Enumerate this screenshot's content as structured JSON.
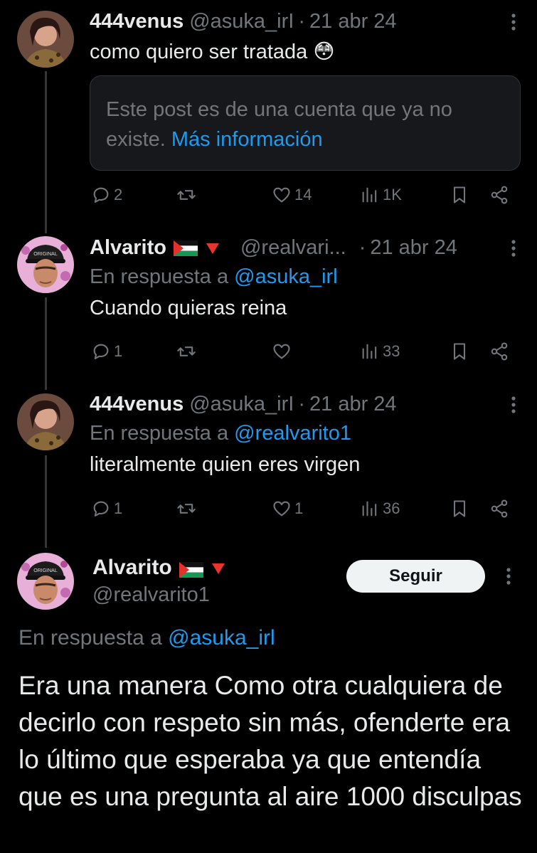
{
  "tweets": [
    {
      "name": "444venus",
      "handle": "@asuka_irI",
      "dot": "·",
      "date": "21 abr 24",
      "text": "como quiero ser tratada 😳",
      "deleted_text": "Este post es de una cuenta que ya no existe.",
      "deleted_link": "Más información",
      "replies": "2",
      "retweets": "",
      "likes": "14",
      "views": "1K"
    },
    {
      "name": "Alvarito",
      "handle": "@realvari...",
      "dot": "·",
      "date": "21 abr 24",
      "reply_prefix": "En respuesta a",
      "reply_to": "@asuka_irl",
      "text": "Cuando quieras reina",
      "replies": "1",
      "retweets": "",
      "likes": "",
      "views": "33"
    },
    {
      "name": "444venus",
      "handle": "@asuka_irI",
      "dot": "·",
      "date": "21 abr 24",
      "reply_prefix": "En respuesta a",
      "reply_to": "@realvarito1",
      "text": "literalmente quien eres virgen",
      "replies": "1",
      "retweets": "",
      "likes": "1",
      "views": "36"
    }
  ],
  "main_tweet": {
    "name": "Alvarito",
    "handle": "@realvarito1",
    "follow_label": "Seguir",
    "reply_prefix": "En respuesta a",
    "reply_to": "@asuka_irl",
    "text": "Era una manera Como otra cualquiera de decirlo con respeto sin más, ofenderte era lo último que esperaba ya que entendía que es una pregunta al aire 1000 disculpas"
  },
  "icons": {
    "reply": "reply-icon",
    "retweet": "retweet-icon",
    "like": "heart-icon",
    "views": "views-icon",
    "bookmark": "bookmark-icon",
    "share": "share-icon",
    "more": "more-icon",
    "flag": "palestine-flag-icon",
    "triangle": "red-triangle-icon"
  },
  "colors": {
    "background": "#000000",
    "text": "#e7e9ea",
    "secondary": "#71767b",
    "link": "#1d9bf0",
    "card": "#16181c",
    "button": "#eff3f4"
  }
}
